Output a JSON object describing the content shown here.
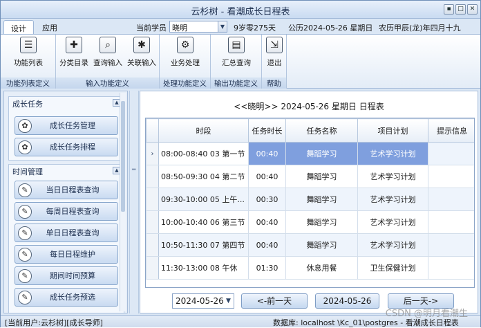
{
  "window": {
    "title": "云杉树 - 看潮成长日程表",
    "min_glyph": "▪",
    "max_glyph": "□",
    "close_glyph": "✕"
  },
  "tabs": [
    "设计",
    "应用"
  ],
  "info": {
    "student_label": "当前学员",
    "student_value": "晓明",
    "age": "9岁零275天",
    "solar_date": "公历2024-05-26 星期日",
    "lunar_date": "农历甲辰(龙)年四月十九"
  },
  "ribbon": {
    "groups": [
      {
        "label": "功能列表定义",
        "buttons": [
          {
            "label": "功能列表",
            "icon": "list-icon",
            "glyph": "☰"
          }
        ]
      },
      {
        "label": "输入功能定义",
        "buttons": [
          {
            "label": "分类目录",
            "icon": "plus-icon",
            "glyph": "✚"
          },
          {
            "label": "查询输入",
            "icon": "search-icon",
            "glyph": "⌕"
          },
          {
            "label": "关联输入",
            "icon": "star-icon",
            "glyph": "✱"
          }
        ]
      },
      {
        "label": "处理功能定义",
        "buttons": [
          {
            "label": "业务处理",
            "icon": "gear-icon",
            "glyph": "⚙"
          }
        ]
      },
      {
        "label": "输出功能定义",
        "buttons": [
          {
            "label": "汇总查询",
            "icon": "document-icon",
            "glyph": "▤"
          }
        ]
      },
      {
        "label": "帮助",
        "buttons": [
          {
            "label": "退出",
            "icon": "exit-icon",
            "glyph": "⇲"
          }
        ]
      }
    ]
  },
  "sidebar": {
    "sections": [
      {
        "title": "成长任务",
        "items": [
          "成长任务管理",
          "成长任务排程"
        ]
      },
      {
        "title": "时间管理",
        "items": [
          "当日日程表查询",
          "每周日程表查询",
          "单日日程表查询",
          "每日日程维护",
          "期间时间预算",
          "成长任务预选"
        ]
      }
    ],
    "collapse_glyph": "▲"
  },
  "schedule": {
    "title": "<<晓明>>   2024-05-26 星期日   日程表",
    "columns": [
      "时段",
      "任务时长",
      "任务名称",
      "项目计划",
      "提示信息"
    ],
    "rows": [
      {
        "period": "08:00-08:40 03  第一节",
        "duration": "00:40",
        "task": "舞蹈学习",
        "plan": "艺术学习计划",
        "hint": ""
      },
      {
        "period": "08:50-09:30 04  第二节",
        "duration": "00:40",
        "task": "舞蹈学习",
        "plan": "艺术学习计划",
        "hint": ""
      },
      {
        "period": "09:30-10:00 05  上午...",
        "duration": "00:30",
        "task": "舞蹈学习",
        "plan": "艺术学习计划",
        "hint": ""
      },
      {
        "period": "10:00-10:40 06  第三节",
        "duration": "00:40",
        "task": "舞蹈学习",
        "plan": "艺术学习计划",
        "hint": ""
      },
      {
        "period": "10:50-11:30 07  第四节",
        "duration": "00:40",
        "task": "舞蹈学习",
        "plan": "艺术学习计划",
        "hint": ""
      },
      {
        "period": "11:30-13:00 08  午休",
        "duration": "01:30",
        "task": "休息用餐",
        "plan": "卫生保健计划",
        "hint": ""
      }
    ],
    "current_row_glyph": "›"
  },
  "controls": {
    "date_value": "2024-05-26",
    "date_arrow": "▼",
    "prev_label": "<-前一天",
    "today_label": "2024-05-26",
    "next_label": "后一天->"
  },
  "status": {
    "user": "[当前用户:云杉树][成长导师]",
    "db": "数据库: localhost \\Kc_01\\postgres - 看潮成长日程表"
  },
  "watermark": "CSDN @明月看潮生"
}
